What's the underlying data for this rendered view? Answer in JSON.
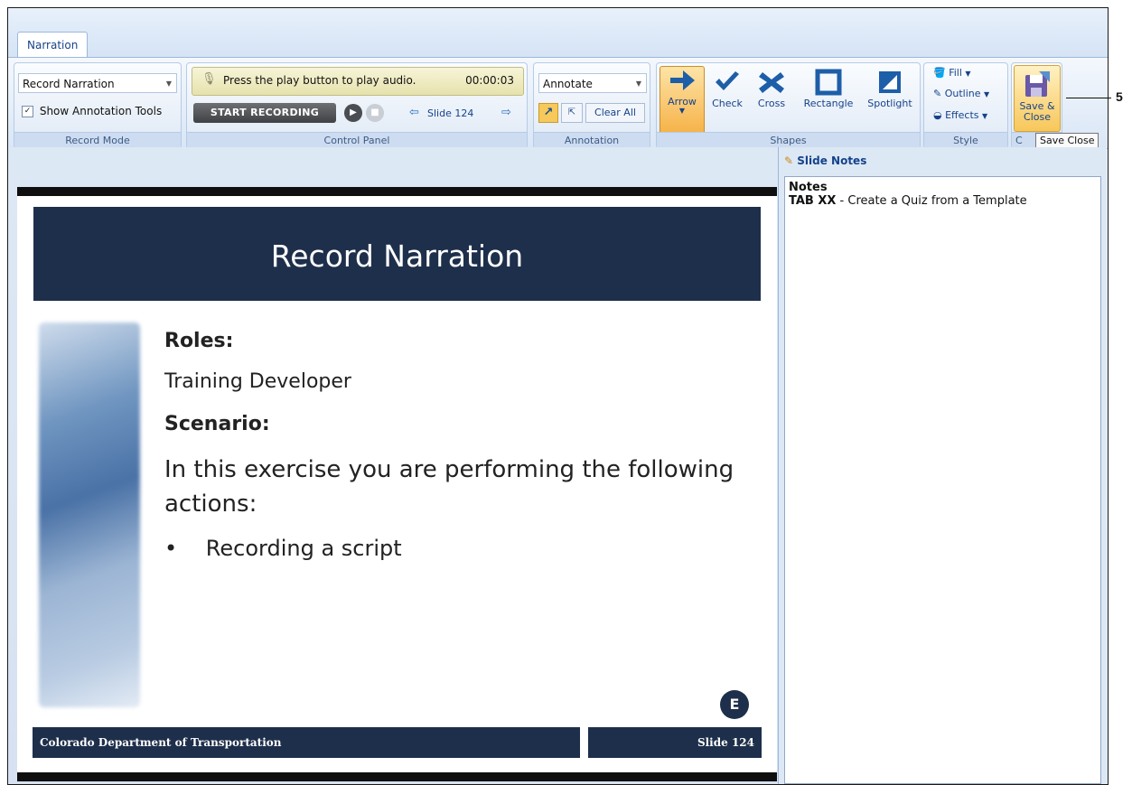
{
  "tabs": [
    "Narration"
  ],
  "record_mode": {
    "combo_value": "Record Narration",
    "checkbox_label": "Show Annotation Tools",
    "checkbox_checked": true,
    "group_label": "Record Mode"
  },
  "control_panel": {
    "status_text": "Press the play button to play audio.",
    "time": "00:00:03",
    "start_recording_label": "START RECORDING",
    "slide_nav_label": "Slide 124",
    "group_label": "Control Panel"
  },
  "annotation": {
    "combo_value": "Annotate",
    "clear_all_label": "Clear All",
    "group_label": "Annotation"
  },
  "shapes": {
    "items": [
      "Arrow",
      "Check",
      "Cross",
      "Rectangle",
      "Spotlight"
    ],
    "group_label": "Shapes"
  },
  "style": {
    "fill_label": "Fill",
    "outline_label": "Outline",
    "effects_label": "Effects",
    "group_label": "Style"
  },
  "close_group": {
    "save_close_label_line1": "Save &",
    "save_close_label_line2": "Close",
    "group_label_partial": "C",
    "tooltip": "Save  Close"
  },
  "callout_number": "5",
  "slide": {
    "title": "Record Narration",
    "roles_heading": "Roles:",
    "roles_text": "Training Developer",
    "scenario_heading": "Scenario:",
    "scenario_text": "In this exercise you are performing the following actions:",
    "bullet": "Recording a script",
    "badge": "E",
    "footer_left": "Colorado Department of Transportation",
    "footer_right": "Slide 124"
  },
  "notes_panel": {
    "header": "Slide Notes",
    "notes_label": "Notes",
    "tab_ref": "TAB XX",
    "notes_text": " - Create a Quiz from a Template"
  },
  "colors": {
    "slide_navy": "#1e2f4b",
    "ribbon_text": "#15428b",
    "selected_orange": "#f7b54a"
  }
}
